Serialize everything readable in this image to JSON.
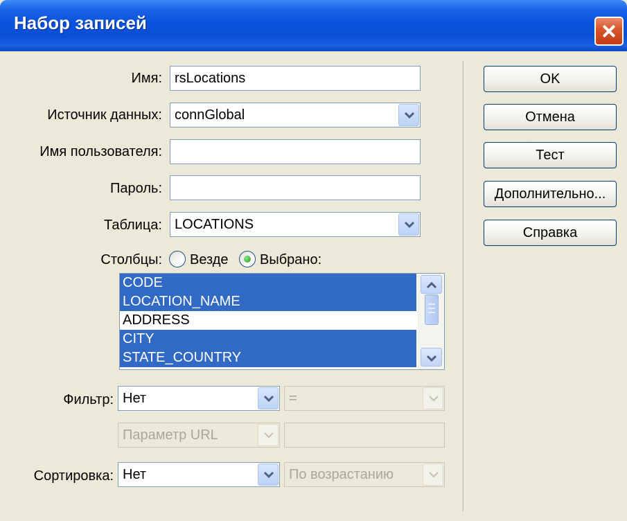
{
  "window": {
    "title": "Набор записей"
  },
  "form": {
    "name_label": "Имя:",
    "name_value": "rsLocations",
    "datasource_label": "Источник данных:",
    "datasource_value": "connGlobal",
    "username_label": "Имя пользователя:",
    "username_value": "",
    "password_label": "Пароль:",
    "password_value": "",
    "table_label": "Таблица:",
    "table_value": "LOCATIONS",
    "columns_label": "Столбцы:",
    "columns_all": "Везде",
    "columns_selected": "Выбрано:",
    "columns_mode": "selected",
    "columns": [
      {
        "name": "CODE",
        "selected": true
      },
      {
        "name": "LOCATION_NAME",
        "selected": true
      },
      {
        "name": "ADDRESS",
        "selected": false
      },
      {
        "name": "CITY",
        "selected": true
      },
      {
        "name": "STATE_COUNTRY",
        "selected": true
      }
    ],
    "filter_label": "Фильтр:",
    "filter_value": "Нет",
    "filter_operator": "=",
    "filter_param": "Параметр URL",
    "filter_param_value": "",
    "sort_label": "Сортировка:",
    "sort_value": "Нет",
    "sort_order": "По возрастанию"
  },
  "buttons": {
    "ok": "OK",
    "cancel": "Отмена",
    "test": "Тест",
    "advanced": "Дополнительно...",
    "help": "Справка"
  },
  "icons": {
    "close": "close-icon",
    "dropdown": "chevron-down-icon",
    "scroll_up": "chevron-up-icon",
    "scroll_down": "chevron-down-icon"
  }
}
